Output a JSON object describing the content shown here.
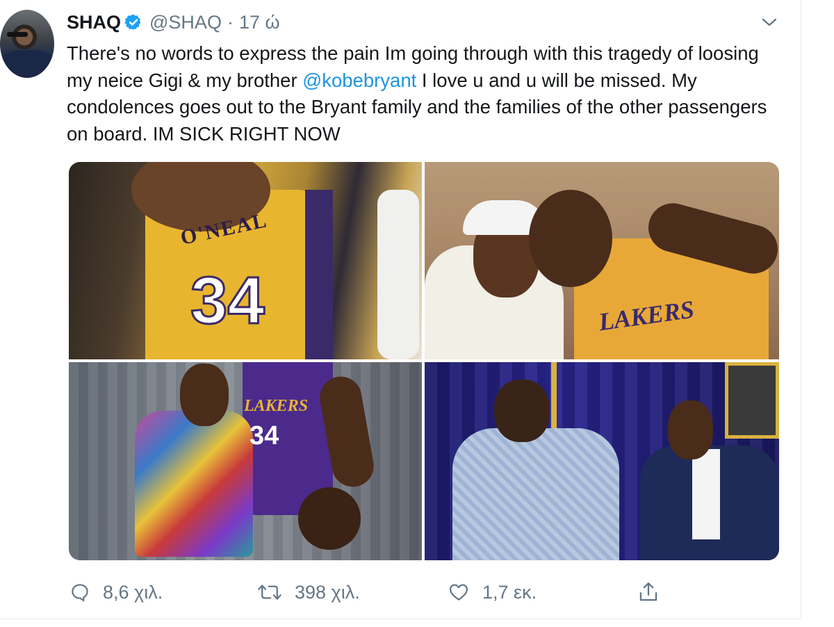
{
  "tweet": {
    "author": {
      "name": "SHAQ",
      "handle": "@SHAQ",
      "separator": "·",
      "time": "17 ώ",
      "verified": true,
      "avatar_icon": "profile-photo"
    },
    "text": {
      "before_mention": "There's no words to express the pain Im going through with this tragedy of loosing my neice Gigi & my brother ",
      "mention": "@kobebryant",
      "after_mention": " I love u and u will be missed. My condolences goes out to the Bryant family and the families of the other passengers on board. IM SICK RIGHT NOW"
    },
    "media": [
      {
        "jersey_name": "O'NEAL",
        "jersey_number": "34"
      },
      {
        "jersey_text": "LAKERS"
      },
      {
        "jersey_text": "LAKERS",
        "jersey_number": "34"
      },
      {}
    ],
    "actions": {
      "reply": {
        "icon": "reply-icon",
        "count": "8,6 χιλ."
      },
      "retweet": {
        "icon": "retweet-icon",
        "count": "398 χιλ."
      },
      "like": {
        "icon": "heart-icon",
        "count": "1,7 εκ."
      },
      "share": {
        "icon": "share-icon"
      }
    },
    "menu_icon": "chevron-down-icon"
  },
  "colors": {
    "link": "#1b95e0",
    "verified": "#1da1f2",
    "secondary_text": "#657786",
    "primary_text": "#14171a"
  }
}
